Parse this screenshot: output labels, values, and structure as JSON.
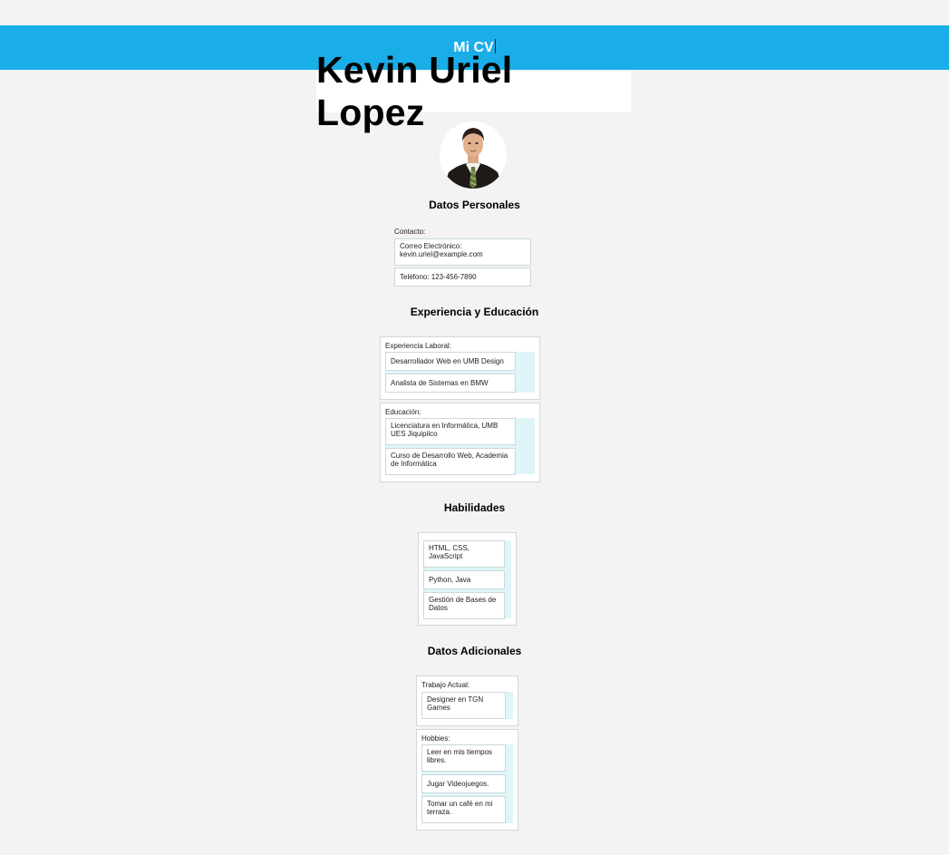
{
  "header": {
    "title": "Mi CV"
  },
  "name": "Kevin Uriel Lopez",
  "sections": {
    "personal": {
      "title": "Datos Personales",
      "contact_label": "Contacto:",
      "email": "Correo Electrónico: kevin.uriel@example.com",
      "phone": "Teléfono: 123-456-7890"
    },
    "experience": {
      "title": "Experiencia y Educación",
      "work_label": "Experiencia Laboral:",
      "work_items": [
        "Desarrollador Web en UMB Design",
        "Analista de Sistemas en BMW"
      ],
      "education_label": "Educación:",
      "education_items": [
        "Licenciatura en Informática, UMB UES Jiquipilco",
        "Curso de Desarrollo Web, Academia de Informática"
      ]
    },
    "skills": {
      "title": "Habilidades",
      "items": [
        "HTML, CSS, JavaScript",
        "Python, Java",
        "Gestión de Bases de Datos"
      ]
    },
    "additional": {
      "title": "Datos Adicionales",
      "job_label": "Trabajo Actual:",
      "job_items": [
        "Designer en TGN Games"
      ],
      "hobbies_label": "Hobbies:",
      "hobbies_items": [
        "Leer en mis tiempos libres.",
        "Jugar Videojuegos.",
        "Tomar un café en mi terraza."
      ]
    }
  },
  "colors": {
    "header_bg": "#1aaee8",
    "strip": "#dff5f8",
    "page_bg": "#f3f3f3"
  },
  "icons": {
    "avatar": "profile-photo"
  }
}
